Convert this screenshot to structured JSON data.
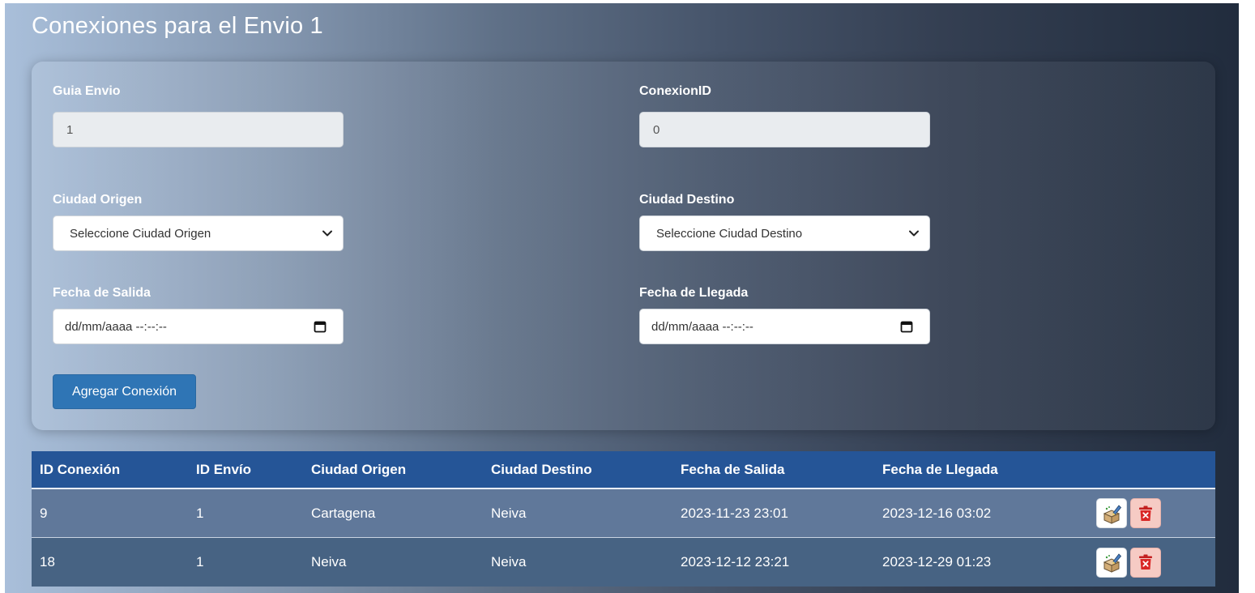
{
  "page": {
    "title": "Conexiones para el Envio 1"
  },
  "form": {
    "guia": {
      "label": "Guia Envio",
      "value": "1"
    },
    "conexion": {
      "label": "ConexionID",
      "value": "0"
    },
    "origen": {
      "label": "Ciudad Origen",
      "selected": "Seleccione Ciudad Origen"
    },
    "destino": {
      "label": "Ciudad Destino",
      "selected": "Seleccione Ciudad Destino"
    },
    "salida": {
      "label": "Fecha de Salida",
      "placeholder": "dd/mm/aaaa --:--:--"
    },
    "llegada": {
      "label": "Fecha de Llegada",
      "placeholder": "dd/mm/aaaa --:--:--"
    },
    "submit_label": "Agregar Conexión"
  },
  "table": {
    "headers": [
      "ID Conexión",
      "ID Envío",
      "Ciudad Origen",
      "Ciudad Destino",
      "Fecha de Salida",
      "Fecha de Llegada"
    ],
    "rows": [
      [
        "9",
        "1",
        "Cartagena",
        "Neiva",
        "2023-11-23 23:01",
        "2023-12-16 03:02"
      ],
      [
        "18",
        "1",
        "Neiva",
        "Neiva",
        "2023-12-12 23:21",
        "2023-12-29 01:23"
      ]
    ]
  },
  "icons": {
    "edit": "edit-box-icon",
    "delete": "trash-icon",
    "select": "chevron-down-icon",
    "date": "calendar-icon"
  },
  "colors": {
    "primary_button": "#2f75b5",
    "table_header": "#255597",
    "delete_button": "#f6cbc4"
  }
}
